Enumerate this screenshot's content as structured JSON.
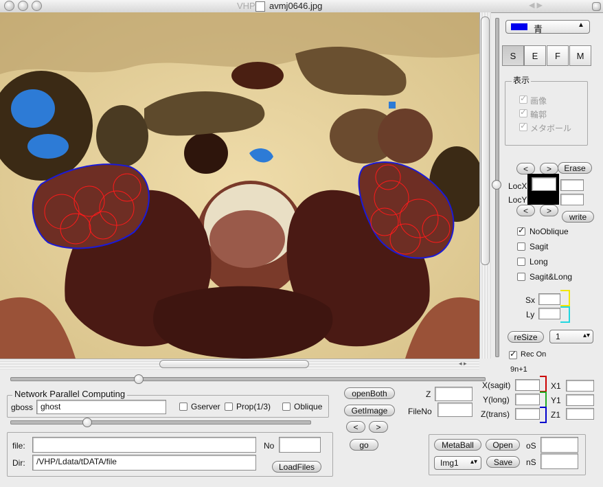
{
  "window": {
    "title": "avmj0646.jpg",
    "ghost_title": "VHP",
    "ghost_right": "◀ ▶"
  },
  "color_select": {
    "color": "#0000ee",
    "value": "青"
  },
  "view_buttons": [
    "S",
    "E",
    "F",
    "M"
  ],
  "display_group": {
    "title": "表示",
    "items": [
      {
        "label": "画像",
        "checked": true
      },
      {
        "label": "輪郭",
        "checked": true
      },
      {
        "label": "メタボール",
        "checked": true
      }
    ]
  },
  "nav": {
    "prev": "<",
    "next": ">",
    "erase": "Erase",
    "write": "write"
  },
  "loc": {
    "x_label": "LocX",
    "y_label": "LocY",
    "x_value": "",
    "y_value": ""
  },
  "options": [
    {
      "label": "NoOblique",
      "checked": true
    },
    {
      "label": "Sagit",
      "checked": false
    },
    {
      "label": "Long",
      "checked": false
    },
    {
      "label": "Sagit&Long",
      "checked": false
    }
  ],
  "scale": {
    "sx_label": "Sx",
    "ly_label": "Ly",
    "sx_color": "#f2e600",
    "ly_color": "#21d6e0"
  },
  "resize": {
    "button": "reSize",
    "value": "1"
  },
  "rec_on": {
    "label": "Rec On",
    "checked": true
  },
  "formula": "9n+1",
  "coords": {
    "rows": [
      {
        "label": "X(sagit)",
        "out": "X1",
        "color": "#cc0000"
      },
      {
        "label": "Y(long)",
        "out": "Y1",
        "color": "#22aa22"
      },
      {
        "label": "Z(trans)",
        "out": "Z1",
        "color": "#0000cc"
      }
    ]
  },
  "network": {
    "title": "Network Parallel Computing",
    "host_label": "gboss",
    "host_value": "ghost",
    "checks": [
      {
        "label": "Gserver",
        "checked": false
      },
      {
        "label": "Prop(1/3)",
        "checked": false
      },
      {
        "label": "Oblique",
        "checked": false
      }
    ]
  },
  "actions": {
    "open_both": "openBoth",
    "get_image": "GetImage",
    "prev": "<",
    "next": ">",
    "go": "go"
  },
  "z": {
    "label": "Z",
    "value": ""
  },
  "file_no": {
    "label": "FileNo",
    "value": ""
  },
  "files": {
    "file_label": "file:",
    "file_value": "",
    "no_label": "No",
    "no_value": "",
    "dir_label": "Dir:",
    "dir_value": "/VHP/Ldata/tDATA/file",
    "load_button": "LoadFiles"
  },
  "metaball": {
    "button": "MetaBall",
    "open": "Open",
    "save": "Save",
    "img_select": "Img1",
    "os_label": "oS",
    "ns_label": "nS",
    "os_value": "",
    "ns_value": ""
  }
}
